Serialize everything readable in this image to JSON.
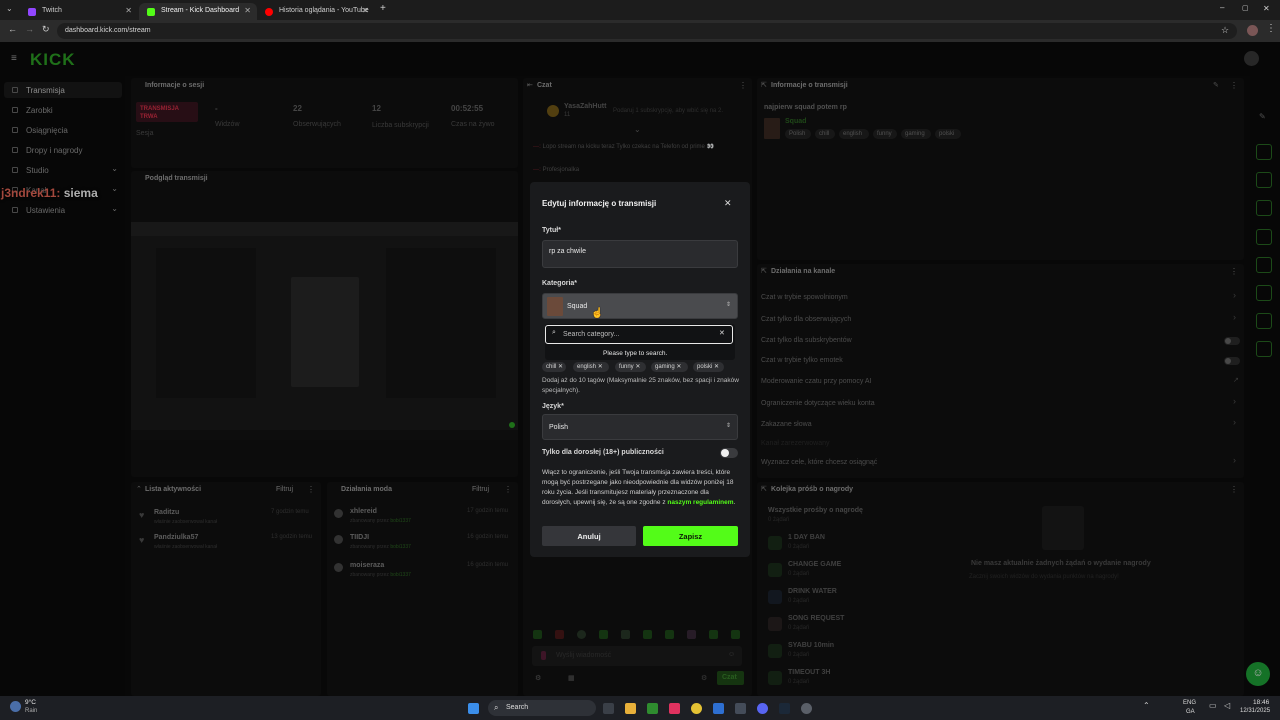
{
  "browser": {
    "tabs": [
      {
        "title": "Twitch",
        "color": "#9146ff"
      },
      {
        "title": "Stream - Kick Dashboard",
        "color": "#53fc18"
      },
      {
        "title": "Historia oglądania - YouTube",
        "color": "#ff0000"
      }
    ],
    "url": "dashboard.kick.com/stream"
  },
  "logo": "KICK",
  "overlay_chat": {
    "user": "j3ndrek11:",
    "message": "siema"
  },
  "sidebar": {
    "items": [
      {
        "label": "Transmisja",
        "active": true
      },
      {
        "label": "Zarobki"
      },
      {
        "label": "Osiągnięcia"
      },
      {
        "label": "Dropy i nagrody"
      },
      {
        "label": "Studio",
        "chevron": true
      },
      {
        "label": "Kanał",
        "chevron": true
      },
      {
        "label": "Ustawienia",
        "chevron": true
      }
    ]
  },
  "session": {
    "title": "Informacje o sesji",
    "badge": "TRANSMISJA TRWA",
    "badge_sub": "Sesja",
    "stats": [
      {
        "value": "-",
        "label": "Widzów"
      },
      {
        "value": "22",
        "label": "Obserwujących"
      },
      {
        "value": "12",
        "label": "Liczba subskrypcji"
      },
      {
        "value": "00:52:55",
        "label": "Czas na żywo"
      }
    ]
  },
  "preview": {
    "title": "Podgląd transmisji"
  },
  "activity": {
    "title": "Lista aktywności",
    "filter": "Filtruj",
    "items": [
      {
        "name": "Raditzu",
        "desc": "właśnie zaobserwował kanał",
        "time": "7 godzin temu"
      },
      {
        "name": "Pandziulka57",
        "desc": "właśnie zaobserwował kanał",
        "time": "13 godzin temu"
      }
    ]
  },
  "modactions": {
    "title": "Działania moda",
    "filter": "Filtruj",
    "items": [
      {
        "name": "xhlereid",
        "desc": "zbanowany przez",
        "by": "bobi1337",
        "time": "17 godzin temu"
      },
      {
        "name": "TIIDJI",
        "desc": "zbanowany przez",
        "by": "bobi1337",
        "time": "16 godzin temu"
      },
      {
        "name": "moiseraza",
        "desc": "zbanowany przez",
        "by": "bobi1337",
        "time": "16 godzin temu"
      }
    ]
  },
  "chat": {
    "title": "Czat",
    "pinned_user": "YasaZahHutt",
    "pinned_text": "Podaruj 1 subskrypcję, aby wbić się na 2.",
    "pinned_sub": "11",
    "msg1": "Lopo stream na kicku teraz Tylko czekac na Telefon od prime 👀",
    "msg2": "Profesjonalka",
    "input_placeholder": "Wyślij wiadomość",
    "send": "Czat"
  },
  "modal": {
    "title": "Edytuj informację o transmisji",
    "title_label": "Tytuł*",
    "title_value": "rp za chwile",
    "category_label": "Kategoria*",
    "category_value": "Squad",
    "search_placeholder": "Search category...",
    "search_hint": "Please type to search.",
    "tags": [
      "chill",
      "english",
      "funny",
      "gaming",
      "polski"
    ],
    "tags_help": "Dodaj aż do 10 tagów (Maksymalnie 25 znaków, bez spacji i znaków specjalnych).",
    "lang_label": "Język*",
    "lang_value": "Polish",
    "adult_label": "Tylko dla dorosłej (18+) publiczności",
    "adult_desc": "Włącz to ograniczenie, jeśli Twoja transmisja zawiera treści, które mogą być postrzegane jako nieodpowiednie dla widzów poniżej 18 roku życia. Jeśli transmitujesz materiały przeznaczone dla dorosłych, upewnij się, że są one zgodne z",
    "adult_link": "naszym regulaminem",
    "cancel": "Anuluj",
    "save": "Zapisz"
  },
  "streaminfo": {
    "title": "Informacje o transmisji",
    "stream_title": "najpierw squad potem rp",
    "category": "Squad",
    "tags": [
      "Polish",
      "chill",
      "english",
      "funny",
      "gaming",
      "polski"
    ]
  },
  "channel_actions": {
    "title": "Działania na kanale",
    "items": [
      {
        "label": "Czat w trybie spowolnionym",
        "control": "chevron"
      },
      {
        "label": "Czat tylko dla obserwujących",
        "control": "chevron"
      },
      {
        "label": "Czat tylko dla subskrybentów",
        "control": "toggle"
      },
      {
        "label": "Czat w trybie tylko emotek",
        "control": "toggle"
      },
      {
        "label": "Moderowanie czatu przy pomocy AI",
        "control": "link"
      },
      {
        "label": "Ograniczenie dotyczące wieku konta",
        "control": "chevron"
      },
      {
        "label": "Zakazane słowa",
        "control": "chevron"
      },
      {
        "label": "Kanał zarezerwowany",
        "control": "none"
      },
      {
        "label": "Wyznacz cele, które chcesz osiągnąć",
        "control": "chevron"
      }
    ]
  },
  "rewards": {
    "title": "Kolejka próśb o nagrody",
    "all_label": "Wszystkie prośby o nagrodę",
    "all_count": "0 żądań",
    "items": [
      {
        "name": "1 DAY BAN",
        "count": "0 żądań"
      },
      {
        "name": "CHANGE GAME",
        "count": "0 żądań"
      },
      {
        "name": "DRINK WATER",
        "count": "0 żądań"
      },
      {
        "name": "SONG REQUEST",
        "count": "0 żądań"
      },
      {
        "name": "SYABU 10min",
        "count": "0 żądań"
      },
      {
        "name": "TIMEOUT 3H",
        "count": "0 żądań"
      }
    ],
    "empty_title": "Nie masz aktualnie żadnych żądań o wydanie nagrody",
    "empty_sub": "Zacznij swoich widzów do wydania punktów na nagrody!"
  },
  "taskbar": {
    "weather_temp": "9°C",
    "weather_desc": "Rain",
    "search": "Search",
    "lang": "ENG",
    "lang2": "GA",
    "time": "18:46",
    "date": "12/31/2025"
  },
  "colors": {
    "accent": "#53fc18",
    "live": "#e0324b",
    "panel": "#121212",
    "modal": "#1a1b1d"
  }
}
